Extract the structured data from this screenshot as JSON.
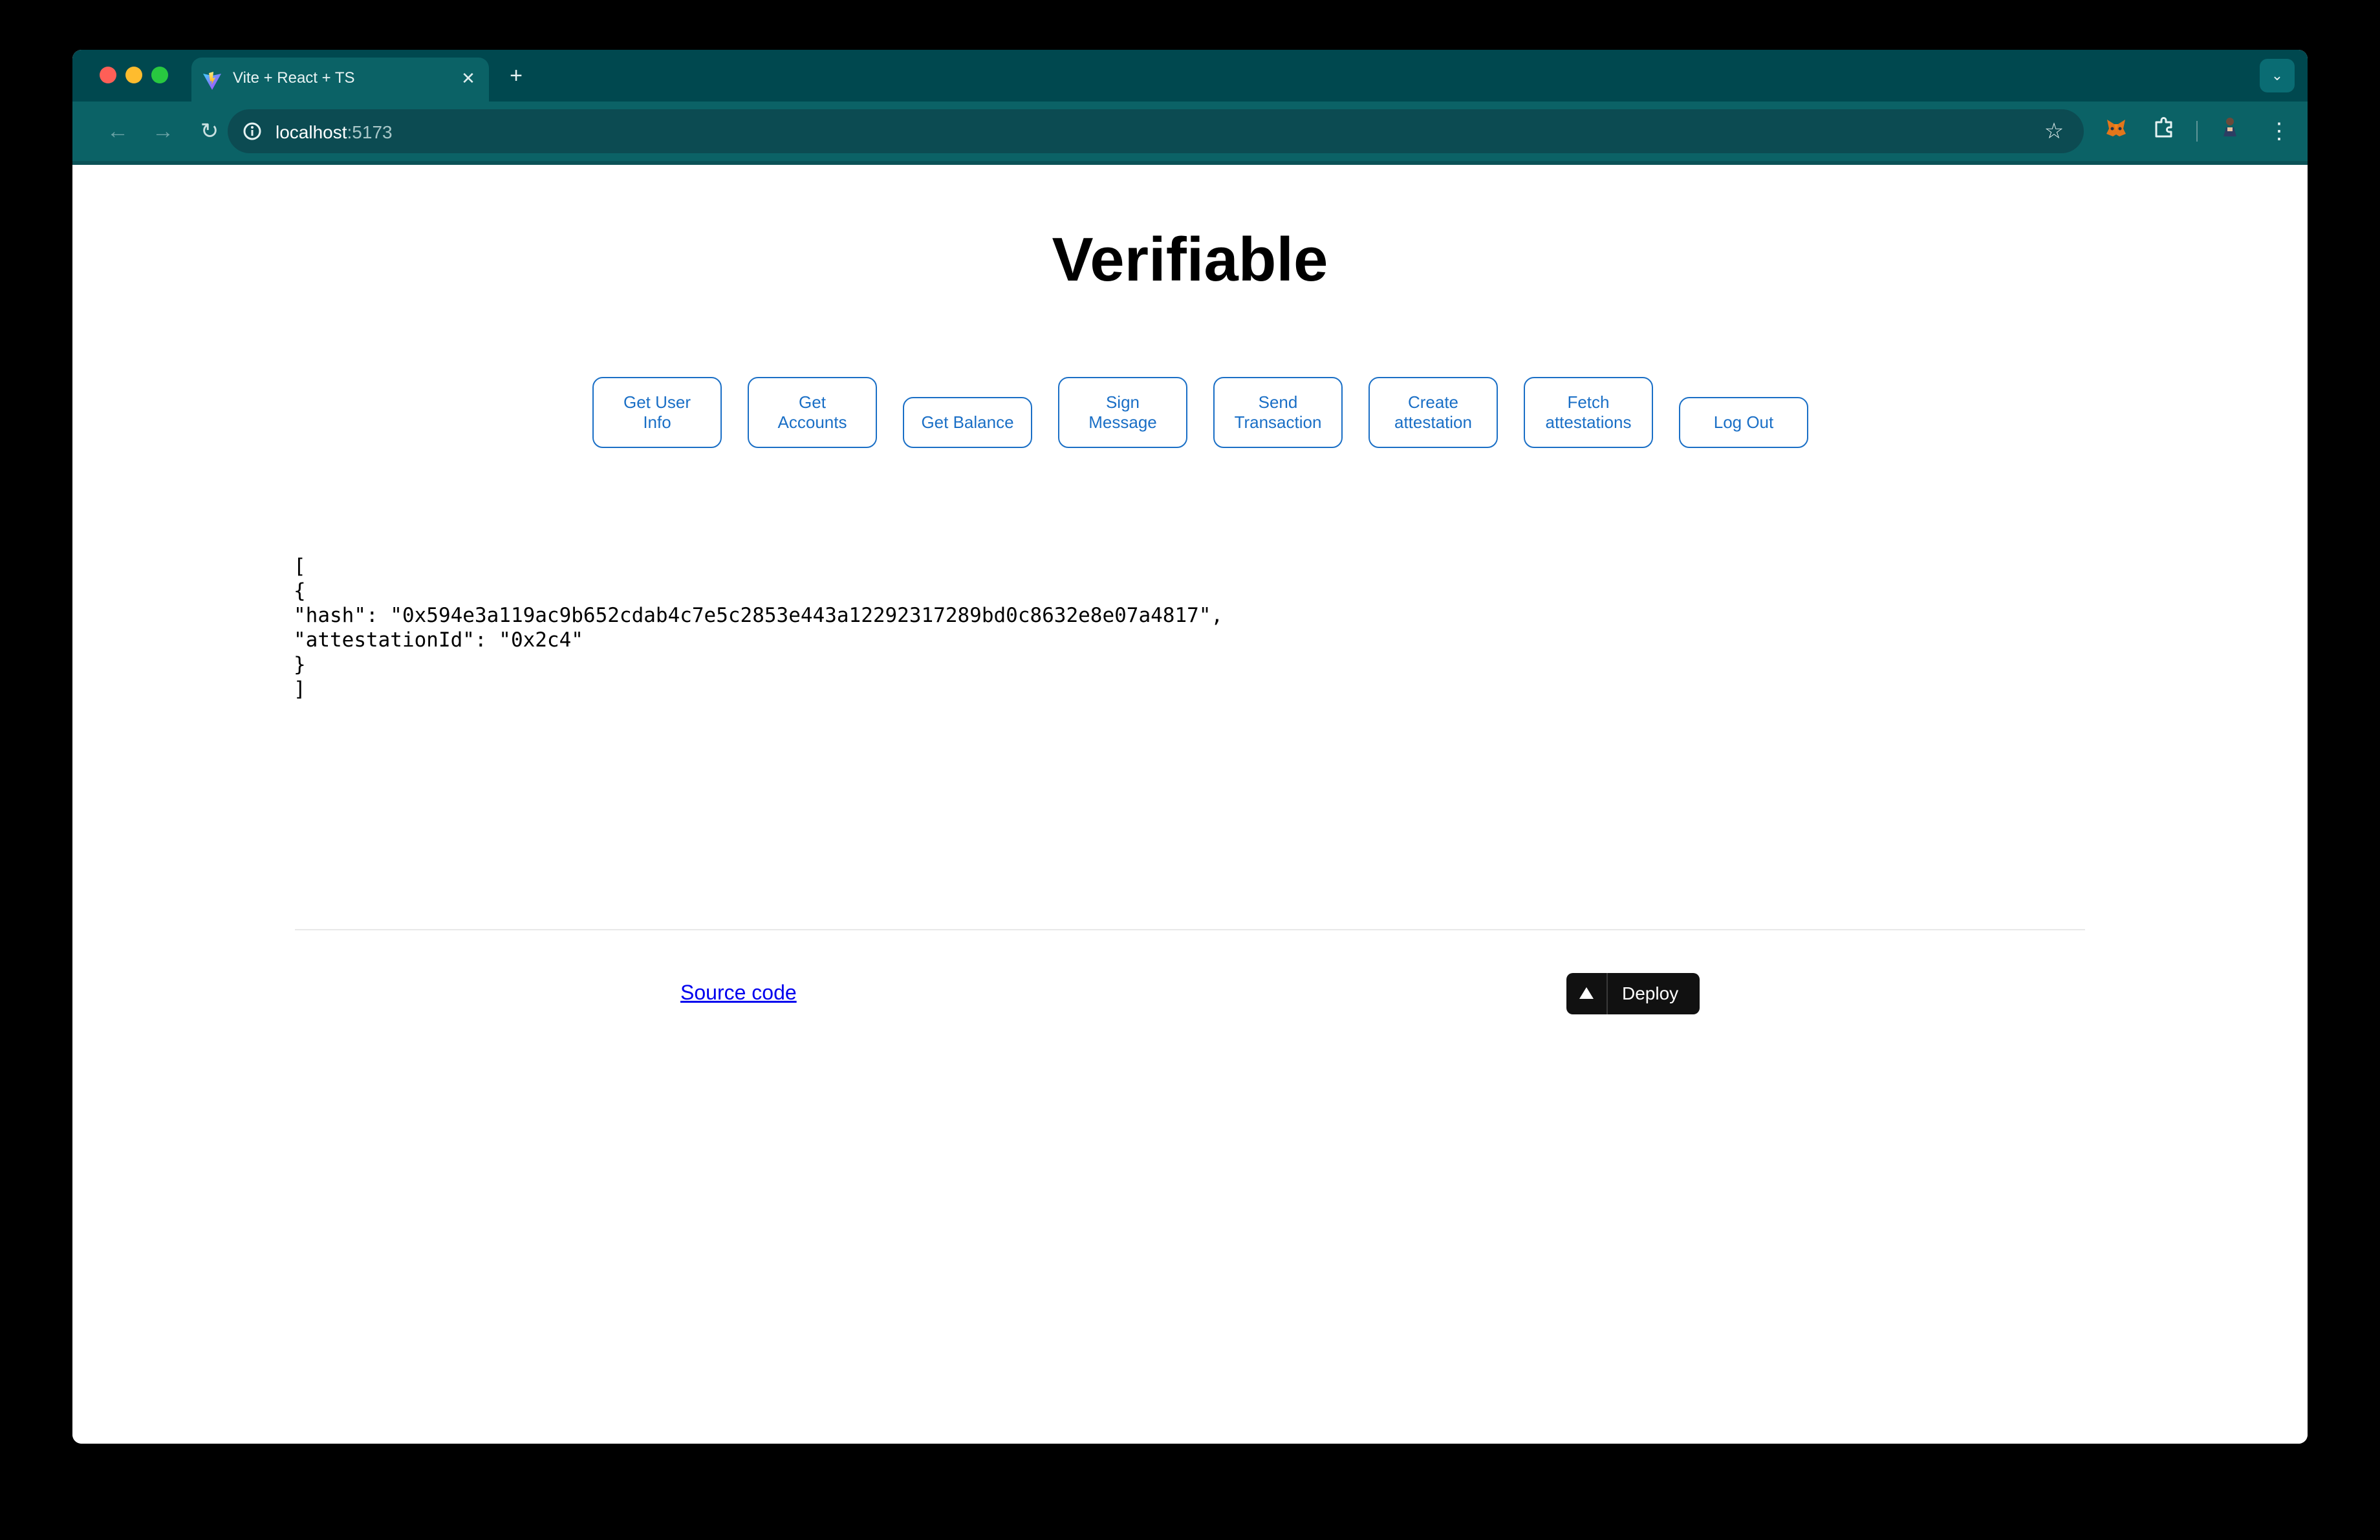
{
  "browser": {
    "tab": {
      "title": "Vite + React + TS",
      "close_glyph": "✕",
      "favicon": "vite-logo"
    },
    "new_tab_glyph": "+",
    "tab_search_glyph": "⌄",
    "toolbar": {
      "back_glyph": "←",
      "forward_glyph": "→",
      "reload_glyph": "↻",
      "url_host": "localhost",
      "url_port": ":5173",
      "bookmark_glyph": "☆",
      "menu_glyph": "⋮"
    },
    "colors": {
      "tabstrip": "#00484f",
      "toolbar": "#0b6266",
      "omnibox": "#0c4b52"
    }
  },
  "page": {
    "title": "Verifiable",
    "buttons": [
      {
        "line1": "Get User",
        "line2": "Info"
      },
      {
        "line1": "Get",
        "line2": "Accounts"
      },
      {
        "line1": "Get Balance",
        "line2": ""
      },
      {
        "line1": "Sign",
        "line2": "Message"
      },
      {
        "line1": "Send",
        "line2": "Transaction"
      },
      {
        "line1": "Create",
        "line2": "attestation"
      },
      {
        "line1": "Fetch",
        "line2": "attestations"
      },
      {
        "line1": "Log Out",
        "line2": ""
      }
    ],
    "output_lines": [
      "[",
      "{",
      "\"hash\": \"0x594e3a119ac9b652cdab4c7e5c2853e443a12292317289bd0c8632e8e07a4817\",",
      "\"attestationId\": \"0x2c4\"",
      "}",
      "]"
    ],
    "footer": {
      "source_link": "Source code",
      "deploy_label": "Deploy"
    },
    "colors": {
      "button_accent": "#1a6fc6",
      "link": "#0000ee",
      "deploy_bg": "#111111"
    }
  }
}
